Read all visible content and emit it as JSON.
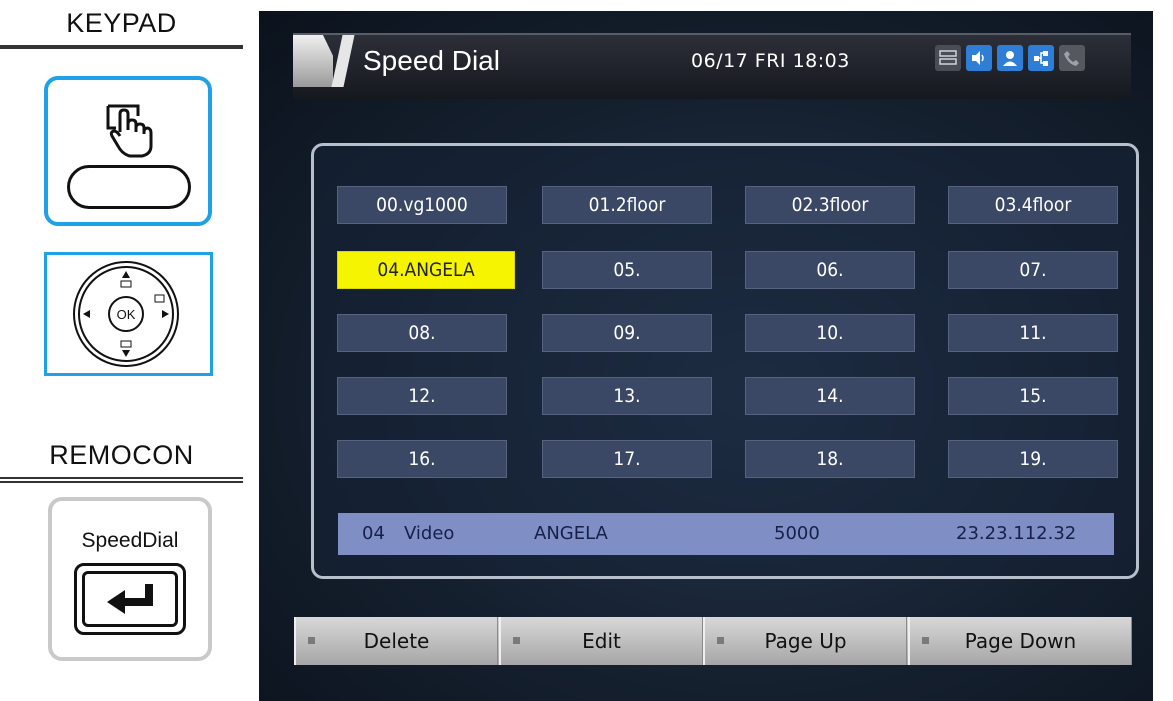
{
  "left_panel": {
    "keypad_label": "KEYPAD",
    "remocon_label": "REMOCON",
    "nav_ok_label": "OK",
    "speeddial_key_label": "SpeedDial"
  },
  "screen": {
    "title": "Speed Dial",
    "datetime": "06/17 FRI 18:03",
    "status_icons": [
      "network-icon",
      "speaker-icon",
      "user-icon",
      "share-icon",
      "phone-icon"
    ],
    "dial_entries": [
      "00.vg1000",
      "01.2floor",
      "02.3floor",
      "03.4floor",
      "04.ANGELA",
      "05.",
      "06.",
      "07.",
      "08.",
      "09.",
      "10.",
      "11.",
      "12.",
      "13.",
      "14.",
      "15.",
      "16.",
      "17.",
      "18.",
      "19."
    ],
    "selected_index": 4,
    "selected_info": {
      "index": "04",
      "type": "Video",
      "name": "ANGELA",
      "number": "5000",
      "address": "23.23.112.32"
    },
    "soft_keys": [
      "Delete",
      "Edit",
      "Page Up",
      "Page Down"
    ]
  },
  "colors": {
    "accent_blue": "#1ea1e8",
    "selected_yellow": "#f7f400",
    "info_bar": "#7f8fc5"
  }
}
